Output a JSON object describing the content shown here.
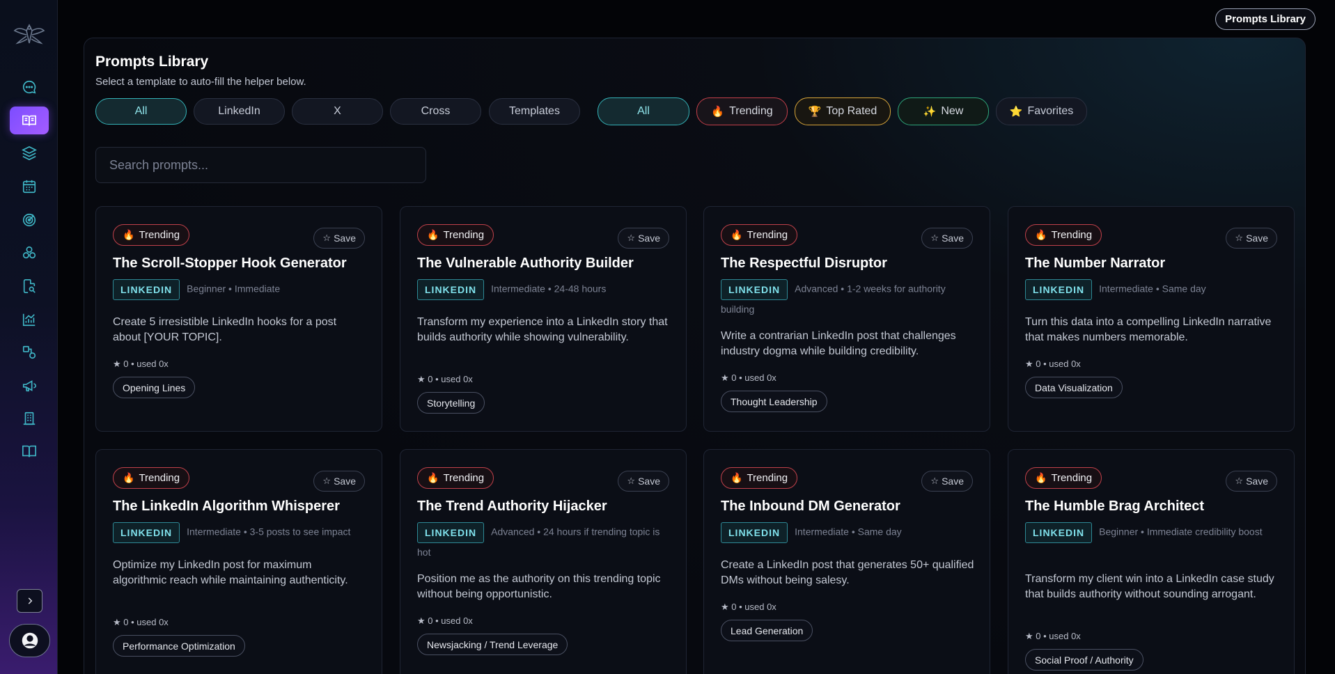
{
  "top_button": "Prompts Library",
  "panel": {
    "title": "Prompts Library",
    "subtitle": "Select a template to auto-fill the helper below."
  },
  "platform_filters": [
    "All",
    "LinkedIn",
    "X",
    "Cross",
    "Templates"
  ],
  "sort_filters": [
    {
      "emoji": "",
      "label": "All"
    },
    {
      "emoji": "🔥",
      "label": "Trending"
    },
    {
      "emoji": "🏆",
      "label": "Top Rated"
    },
    {
      "emoji": "✨",
      "label": "New"
    },
    {
      "emoji": "⭐",
      "label": "Favorites"
    }
  ],
  "search": {
    "placeholder": "Search prompts...",
    "value": ""
  },
  "save_label": "Save",
  "cards": [
    {
      "badge_emoji": "🔥",
      "badge": "Trending",
      "title": "The Scroll-Stopper Hook Generator",
      "platform": "LINKEDIN",
      "meta": "Beginner • Immediate",
      "desc": "Create 5 irresistible LinkedIn hooks for a post about [YOUR TOPIC].",
      "stats": "★ 0 • used 0x",
      "category": "Opening Lines"
    },
    {
      "badge_emoji": "🔥",
      "badge": "Trending",
      "title": "The Vulnerable Authority Builder",
      "platform": "LINKEDIN",
      "meta": "Intermediate • 24-48 hours",
      "desc": "Transform my experience into a LinkedIn story that builds authority while showing vulnerability.",
      "stats": "★ 0 • used 0x",
      "category": "Storytelling"
    },
    {
      "badge_emoji": "🔥",
      "badge": "Trending",
      "title": "The Respectful Disruptor",
      "platform": "LINKEDIN",
      "meta": "Advanced • 1-2 weeks for authority building",
      "desc": "Write a contrarian LinkedIn post that challenges industry dogma while building credibility.",
      "stats": "★ 0 • used 0x",
      "category": "Thought Leadership"
    },
    {
      "badge_emoji": "🔥",
      "badge": "Trending",
      "title": "The Number Narrator",
      "platform": "LINKEDIN",
      "meta": "Intermediate • Same day",
      "desc": "Turn this data into a compelling LinkedIn narrative that makes numbers memorable.",
      "stats": "★ 0 • used 0x",
      "category": "Data Visualization"
    },
    {
      "badge_emoji": "🔥",
      "badge": "Trending",
      "title": "The LinkedIn Algorithm Whisperer",
      "platform": "LINKEDIN",
      "meta": "Intermediate • 3-5 posts to see impact",
      "desc": "Optimize my LinkedIn post for maximum algorithmic reach while maintaining authenticity.",
      "stats": "★ 0 • used 0x",
      "category": "Performance Optimization"
    },
    {
      "badge_emoji": "🔥",
      "badge": "Trending",
      "title": "The Trend Authority Hijacker",
      "platform": "LINKEDIN",
      "meta": "Advanced • 24 hours if trending topic is hot",
      "desc": "Position me as the authority on this trending topic without being opportunistic.",
      "stats": "★ 0 • used 0x",
      "category": "Newsjacking / Trend Leverage"
    },
    {
      "badge_emoji": "🔥",
      "badge": "Trending",
      "title": "The Inbound DM Generator",
      "platform": "LINKEDIN",
      "meta": "Intermediate • Same day",
      "desc": "Create a LinkedIn post that generates 50+ qualified DMs without being salesy.",
      "stats": "★ 0 • used 0x",
      "category": "Lead Generation"
    },
    {
      "badge_emoji": "🔥",
      "badge": "Trending",
      "title": "The Humble Brag Architect",
      "platform": "LINKEDIN",
      "meta": "Beginner • Immediate credibility boost",
      "desc": "Transform my client win into a LinkedIn case study that builds authority without sounding arrogant.",
      "stats": "★ 0 • used 0x",
      "category": "Social Proof / Authority"
    }
  ],
  "sidebar": {
    "icons": [
      "chat-icon",
      "book-open-icon",
      "layers-icon",
      "calendar-icon",
      "target-icon",
      "circles-icon",
      "file-search-icon",
      "chart-line-icon",
      "shapes-icon",
      "megaphone-icon",
      "building-icon",
      "book-icon"
    ],
    "active_index": 1,
    "accent": "#8b5cf6"
  },
  "colors": {
    "teal": "#34b3b8",
    "trending": "#c1414b",
    "background": "#030407"
  }
}
